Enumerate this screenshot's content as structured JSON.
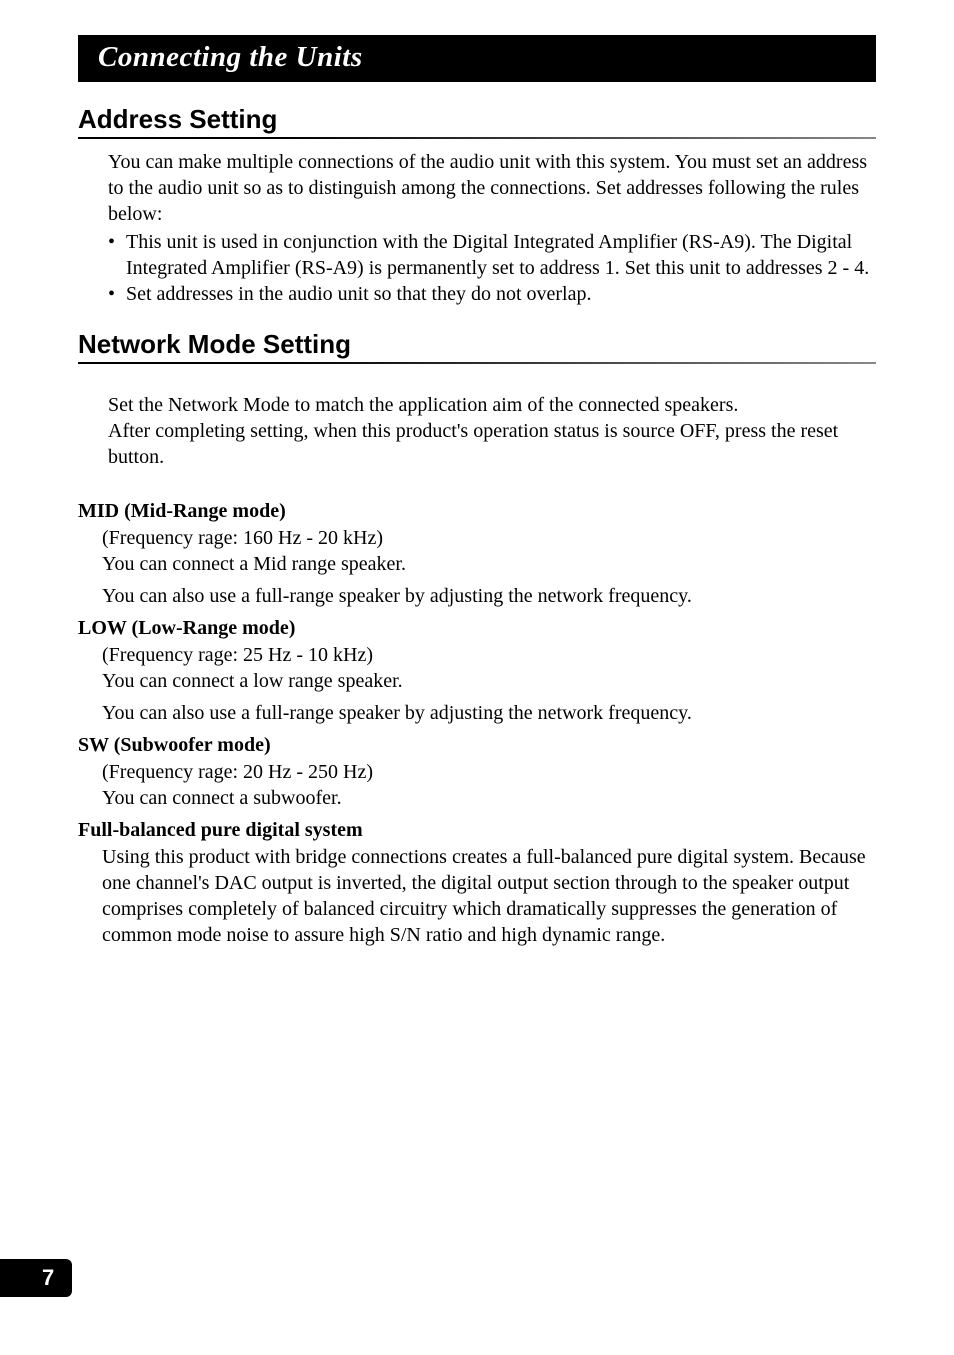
{
  "chapter_title": "Connecting the Units",
  "page_number": "7",
  "sections": [
    {
      "heading": "Address Setting",
      "intro": "You can make multiple connections of the audio unit with this system. You must set an address to the audio unit so as to distinguish among the connections. Set addresses following the rules below:",
      "bullets": [
        "This unit is used in conjunction with the Digital Integrated Amplifier (RS-A9). The Digital Integrated Amplifier (RS-A9) is permanently set to address 1. Set this unit to addresses 2 - 4.",
        "Set addresses in the audio unit so that they do not overlap."
      ]
    },
    {
      "heading": "Network Mode Setting",
      "intro": "Set the Network Mode to match the application aim of the connected speakers.\nAfter completing setting, when this product's operation status is source OFF, press the reset button.",
      "subsections": [
        {
          "title": "MID (Mid-Range mode)",
          "lines": [
            "(Frequency rage: 160 Hz - 20 kHz)\nYou can connect a Mid range speaker.",
            "You can also use a full-range speaker by adjusting the network frequency."
          ]
        },
        {
          "title": "LOW (Low-Range mode)",
          "lines": [
            "(Frequency rage: 25 Hz - 10 kHz)\nYou can connect a low range speaker.",
            "You can also use a full-range speaker by adjusting the network frequency."
          ]
        },
        {
          "title": "SW (Subwoofer mode)",
          "lines": [
            "(Frequency rage: 20 Hz - 250 Hz)\nYou can connect a subwoofer."
          ]
        },
        {
          "title": "Full-balanced pure digital system",
          "lines": [
            "Using this product with bridge connections creates a full-balanced pure digital system. Because one channel's DAC output is inverted, the digital output section through to the speaker output comprises completely of balanced circuitry which dramatically suppresses the generation of common mode noise to assure high S/N ratio and high dynamic range."
          ]
        }
      ]
    }
  ]
}
